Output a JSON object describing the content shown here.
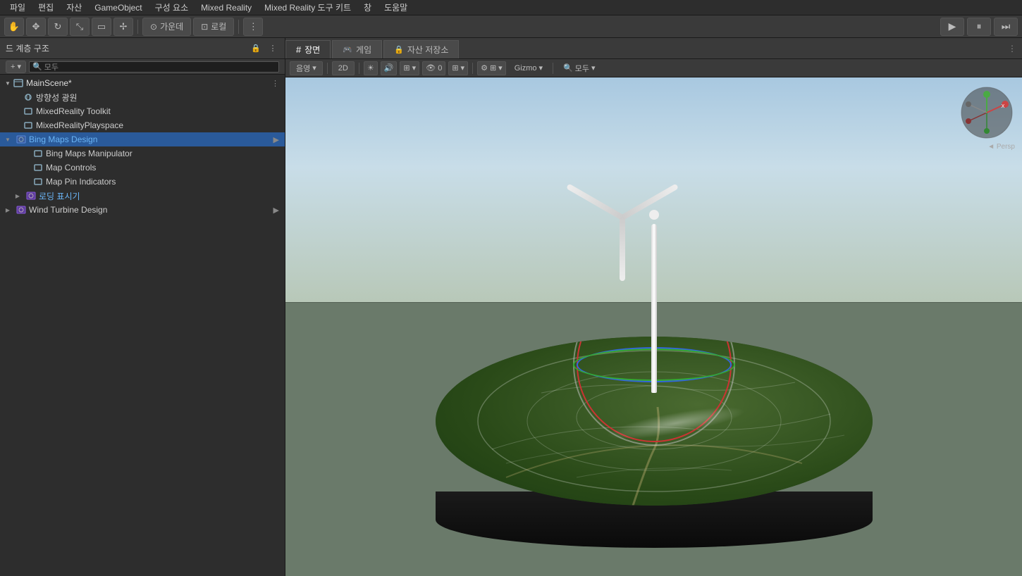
{
  "menuBar": {
    "items": [
      "파일",
      "편집",
      "자산",
      "GameObject",
      "구성 요소",
      "Mixed Reality",
      "Mixed Reality 도구 키트",
      "창",
      "도움말"
    ]
  },
  "toolbar": {
    "tools": [
      "hand",
      "move",
      "rotate",
      "scale",
      "rect",
      "transform"
    ],
    "centerLabel": "가운데",
    "localLabel": "로컬",
    "playBtn": "▶",
    "pauseBtn": "⏸",
    "stepBtn": "⏭"
  },
  "hierarchy": {
    "title": "드 계층 구조",
    "searchPlaceholder": "모두",
    "items": [
      {
        "id": "main-scene",
        "label": "MainScene*",
        "level": 0,
        "hasChildren": true,
        "expanded": true,
        "type": "scene"
      },
      {
        "id": "light",
        "label": "방향성 광원",
        "level": 1,
        "hasChildren": false,
        "type": "object"
      },
      {
        "id": "mr-toolkit",
        "label": "MixedReality Toolkit",
        "level": 1,
        "hasChildren": false,
        "type": "object"
      },
      {
        "id": "mr-playspace",
        "label": "MixedRealityPlayspace",
        "level": 1,
        "hasChildren": false,
        "type": "object"
      },
      {
        "id": "bing-maps",
        "label": "Bing Maps Design",
        "level": 1,
        "hasChildren": true,
        "expanded": true,
        "type": "object",
        "active": true
      },
      {
        "id": "bing-manipulator",
        "label": "Bing Maps Manipulator",
        "level": 2,
        "hasChildren": false,
        "type": "object"
      },
      {
        "id": "map-controls",
        "label": "Map Controls",
        "level": 2,
        "hasChildren": false,
        "type": "object"
      },
      {
        "id": "map-pins",
        "label": "Map Pin Indicators",
        "level": 2,
        "hasChildren": false,
        "type": "object"
      },
      {
        "id": "loading",
        "label": "로딩 표시기",
        "level": 2,
        "hasChildren": true,
        "type": "object"
      },
      {
        "id": "wind-turbine",
        "label": "Wind Turbine Design",
        "level": 1,
        "hasChildren": true,
        "type": "object"
      }
    ]
  },
  "sceneTabs": [
    {
      "id": "scene",
      "label": "장면",
      "icon": "#",
      "active": true
    },
    {
      "id": "game",
      "label": "게임",
      "icon": "🎮",
      "active": false
    },
    {
      "id": "asset-store",
      "label": "자산 저장소",
      "icon": "🔒",
      "active": false
    }
  ],
  "sceneToolbar": {
    "shadingLabel": "음영",
    "twoDLabel": "2D",
    "gizmoLabel": "Gizmo",
    "allLabel": "모두",
    "allLabel2": "모두"
  },
  "axisGizmo": {
    "xLabel": "X",
    "perspLabel": "◄ Persp"
  }
}
